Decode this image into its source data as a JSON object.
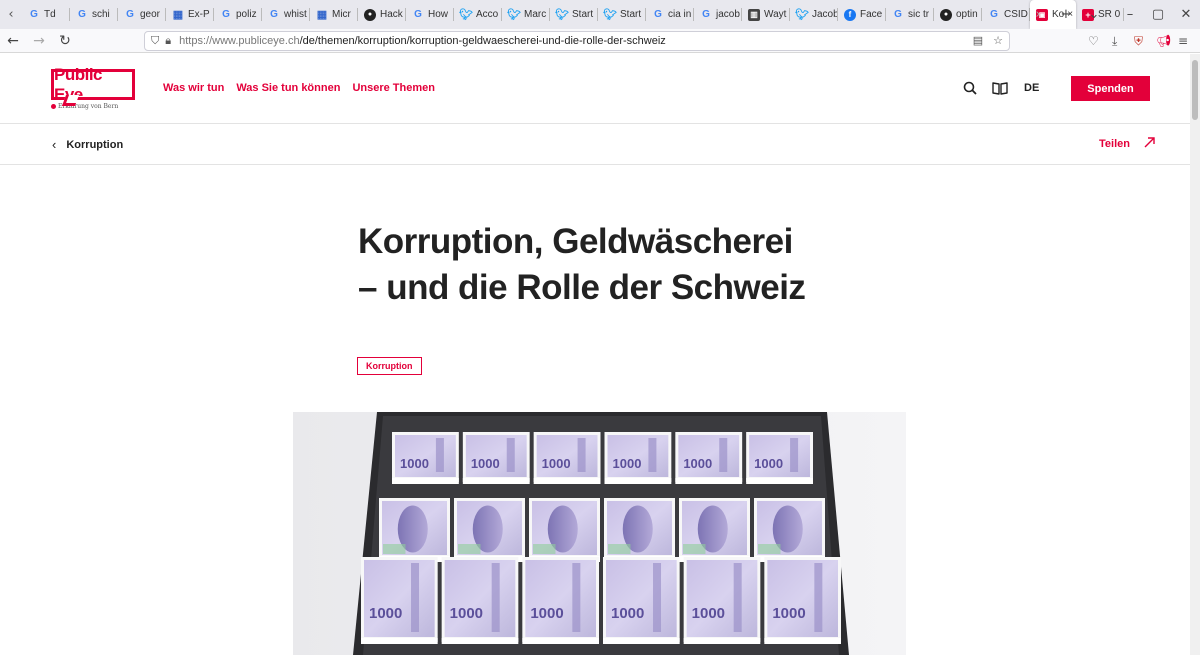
{
  "browser": {
    "tabs": [
      {
        "label": "Td",
        "icon": "td-icon",
        "kind": "g"
      },
      {
        "label": "schi",
        "icon": "google-icon",
        "kind": "g"
      },
      {
        "label": "geor",
        "icon": "google-icon",
        "kind": "g"
      },
      {
        "label": "Ex-P",
        "icon": "page-icon",
        "kind": "ms"
      },
      {
        "label": "poliz",
        "icon": "google-icon",
        "kind": "g"
      },
      {
        "label": "whist",
        "icon": "google-icon",
        "kind": "g"
      },
      {
        "label": "Micr",
        "icon": "microsoft-icon",
        "kind": "ms"
      },
      {
        "label": "Hack",
        "icon": "github-icon",
        "kind": "gh"
      },
      {
        "label": "How",
        "icon": "page-icon",
        "kind": "g"
      },
      {
        "label": "Acco",
        "icon": "twitter-icon",
        "kind": "tw"
      },
      {
        "label": "Marc",
        "icon": "twitter-icon",
        "kind": "tw"
      },
      {
        "label": "Start",
        "icon": "twitter-icon",
        "kind": "tw"
      },
      {
        "label": "Start",
        "icon": "twitter-icon",
        "kind": "tw"
      },
      {
        "label": "cia in",
        "icon": "google-icon",
        "kind": "g"
      },
      {
        "label": "jacob",
        "icon": "google-icon",
        "kind": "g"
      },
      {
        "label": "Wayt",
        "icon": "wayback-icon",
        "kind": "bk"
      },
      {
        "label": "Jacob",
        "icon": "twitter-icon",
        "kind": "tw"
      },
      {
        "label": "Face",
        "icon": "facebook-icon",
        "kind": "fb"
      },
      {
        "label": "sic tr",
        "icon": "google-icon",
        "kind": "g"
      },
      {
        "label": "optin",
        "icon": "github-icon",
        "kind": "gh"
      },
      {
        "label": "CSID",
        "icon": "google-icon",
        "kind": "g"
      }
    ],
    "active_tab": {
      "label": "Ko",
      "close": "×"
    },
    "last_tab": {
      "label": "SR 0"
    },
    "url_host": "https://www.publiceye.ch",
    "url_path": "/de/themen/korruption/korruption-geldwaescherei-und-die-rolle-der-schweiz"
  },
  "site": {
    "logo_text": "Public Eye",
    "logo_sub": "Erklärung von Bern",
    "nav": [
      "Was wir tun",
      "Was Sie tun können",
      "Unsere Themen"
    ],
    "lang": "DE",
    "donate": "Spenden",
    "accent": "#e3003a"
  },
  "subbar": {
    "back_label": "Korruption",
    "share_label": "Teilen"
  },
  "article": {
    "title_line1": "Korruption, Geldwäscherei",
    "title_line2": "– und die Rolle der Schweiz",
    "tag": "Korruption",
    "banknote_value": "1000"
  }
}
